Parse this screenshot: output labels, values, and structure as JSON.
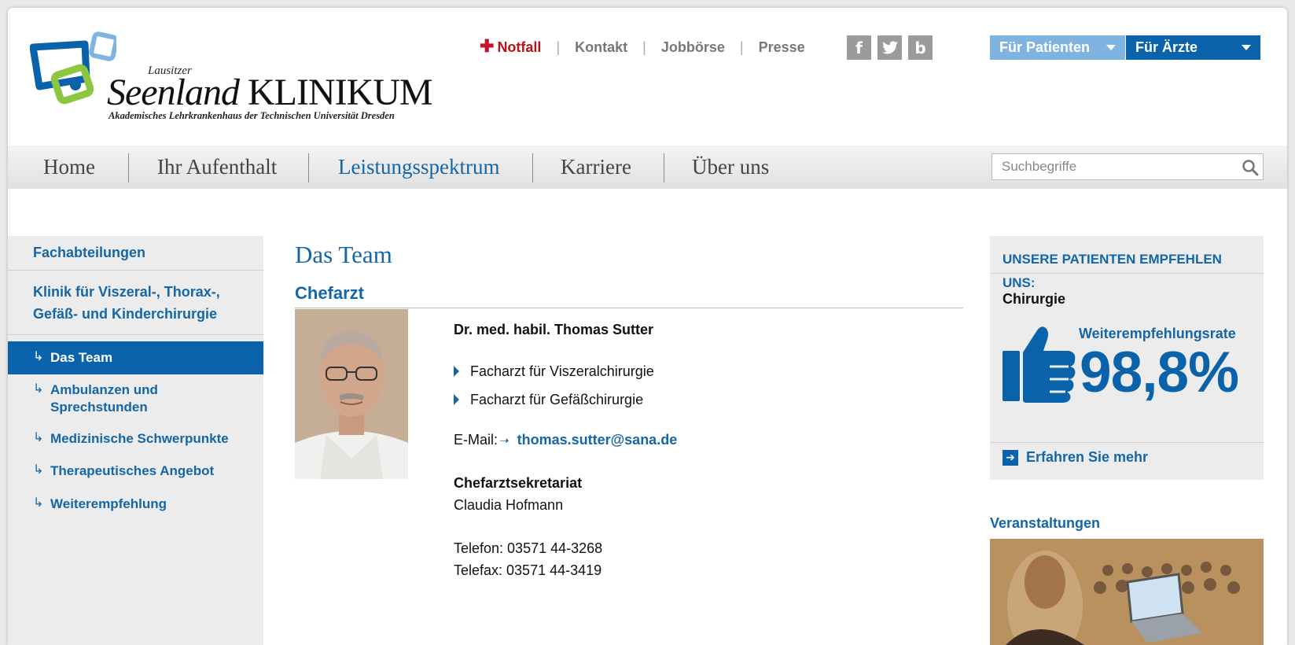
{
  "header": {
    "logo_small": "Lausitzer",
    "logo_seenland": "Seenland",
    "logo_klinikum": "KLINIKUM",
    "logo_tagline": "Akademisches Lehrkrankenhaus der Technischen Universität Dresden",
    "top_links": {
      "notfall": "Notfall",
      "kontakt": "Kontakt",
      "jobboerse": "Jobbörse",
      "presse": "Presse",
      "separator": "|"
    },
    "social": {
      "facebook": "f",
      "twitter": "t",
      "blog": "b"
    },
    "audience": {
      "patients": "Für Patienten",
      "doctors": "Für Ärzte"
    }
  },
  "main_nav": {
    "items": [
      "Home",
      "Ihr Aufenthalt",
      "Leistungsspektrum",
      "Karriere",
      "Über uns"
    ],
    "active": "Leistungsspektrum",
    "search_placeholder": "Suchbegriffe"
  },
  "sidebar": {
    "section": "Fachabteilungen",
    "department": "Klinik für Viszeral-, Thorax-, Gefäß- und Kinderchirurgie",
    "arrow": "↳",
    "items": [
      "Das Team",
      "Ambulanzen und Sprechstunden",
      "Medizinische Schwerpunkte",
      "Therapeutisches Angebot",
      "Weiterempfehlung"
    ],
    "active": "Das Team"
  },
  "content": {
    "title": "Das Team",
    "subtitle": "Chefarzt",
    "name": "Dr. med. habil. Thomas Sutter",
    "qualifications": [
      "Facharzt für Viszeralchirurgie",
      "Facharzt für Gefäßchirurgie"
    ],
    "email_label": "E-Mail:",
    "email_arrow": "➝",
    "email": "thomas.sutter@sana.de",
    "secretariat_title": "Chefarztsekretariat",
    "secretariat_name": "Claudia Hofmann",
    "phone": "Telefon: 03571 44-3268",
    "fax": "Telefax: 03571 44-3419"
  },
  "recommend": {
    "title": "UNSERE PATIENTEN EMPFEHLEN",
    "title2": "UNS:",
    "department": "Chirurgie",
    "rate_label": "Weiterempfehlungsrate",
    "rate": "98,8%",
    "more_arrow": "➔",
    "more": "Erfahren Sie mehr"
  },
  "events": {
    "title": "Veranstaltungen"
  },
  "colors": {
    "brand_blue": "#0a63aa",
    "link_blue": "#1566a6",
    "light_blue": "#7fb4e1",
    "emergency_red": "#b5121b"
  }
}
